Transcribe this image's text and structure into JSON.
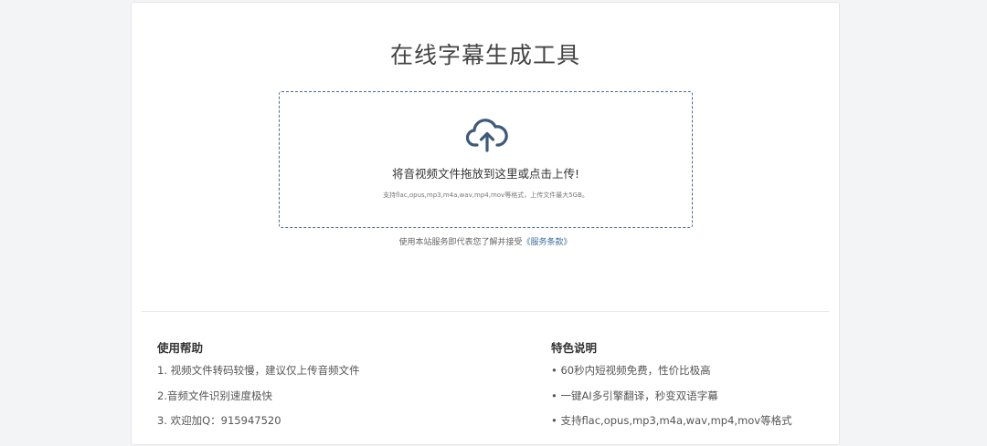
{
  "page": {
    "title": "在线字幕生成工具"
  },
  "upload": {
    "icon": "cloud-upload-icon",
    "drop_text": "将音视频文件拖放到这里或点击上传!",
    "formats_text": "支持flac,opus,mp3,m4a,wav,mp4,mov等格式，上传文件最大5GB。"
  },
  "terms": {
    "prefix": "使用本站服务即代表您了解并接受",
    "link": "《服务条款》"
  },
  "help": {
    "heading": "使用帮助",
    "items": [
      "1. 视频文件转码较慢，建议仅上传音频文件",
      "2.音频文件识别速度极快",
      "3. 欢迎加Q：915947520"
    ]
  },
  "features": {
    "heading": "特色说明",
    "items": [
      "• 60秒内短视频免费，性价比极高",
      "• 一键AI多引擎翻译，秒变双语字幕",
      "• 支持flac,opus,mp3,m4a,wav,mp4,mov等格式"
    ]
  },
  "colors": {
    "accent": "#4a6b8f",
    "link": "#3b6e9e",
    "background": "#f3f4f5"
  }
}
